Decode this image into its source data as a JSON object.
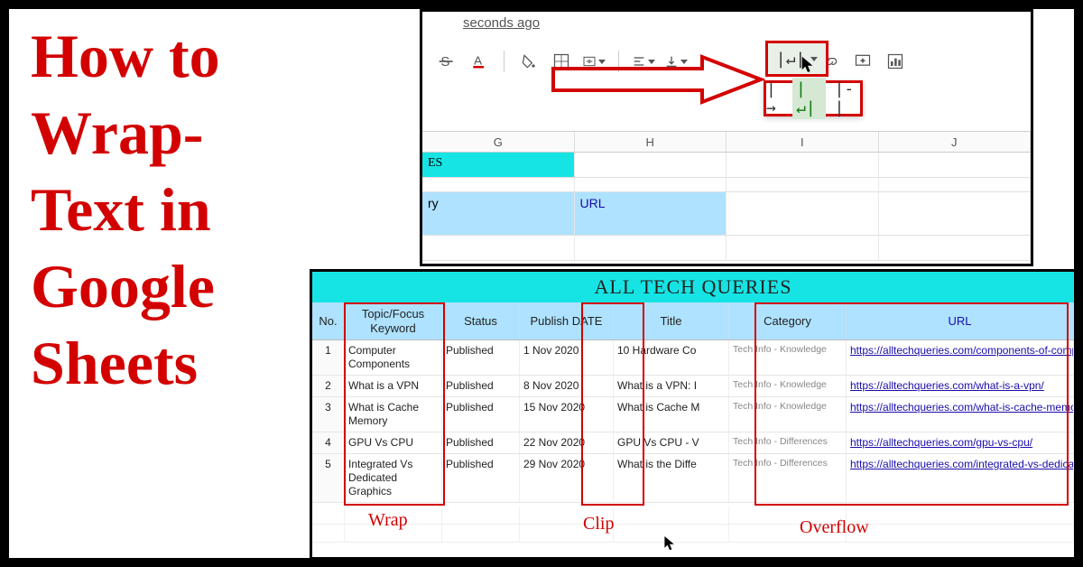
{
  "title_lines": "How to Wrap-Text in Google Sheets",
  "toolbar": {
    "status_text": "seconds ago",
    "col_headers": [
      "G",
      "H",
      "I",
      "J"
    ],
    "cell_es": "ES",
    "cell_ry": "ry",
    "cell_url": "URL"
  },
  "sheet": {
    "title": "ALL TECH QUERIES",
    "headers": {
      "no": "No.",
      "keyword": "Topic/Focus Keyword",
      "status": "Status",
      "date": "Publish DATE",
      "title": "Title",
      "category": "Category",
      "url": "URL"
    },
    "rows": [
      {
        "no": "1",
        "kw": "Computer Components",
        "st": "Published",
        "dt": "1 Nov 2020",
        "ti": "10 Hardware Co",
        "cat": "Tech Info - Knowledge",
        "url": "https://alltechqueries.com/components-of-computer/"
      },
      {
        "no": "2",
        "kw": "What is a VPN",
        "st": "Published",
        "dt": "8 Nov 2020",
        "ti": "What is a VPN: I",
        "cat": "Tech Info - Knowledge",
        "url": "https://alltechqueries.com/what-is-a-vpn/"
      },
      {
        "no": "3",
        "kw": "What is Cache Memory",
        "st": "Published",
        "dt": "15 Nov 2020",
        "ti": "What is Cache M",
        "cat": "Tech Info - Knowledge",
        "url": "https://alltechqueries.com/what-is-cache-memory/"
      },
      {
        "no": "4",
        "kw": "GPU Vs CPU",
        "st": "Published",
        "dt": "22 Nov 2020",
        "ti": "GPU Vs CPU - V",
        "cat": "Tech Info - Differences",
        "url": "https://alltechqueries.com/gpu-vs-cpu/"
      },
      {
        "no": "5",
        "kw": "Integrated Vs Dedicated Graphics",
        "st": "Published",
        "dt": "29 Nov 2020",
        "ti": "What is the Diffe",
        "cat": "Tech Info - Differences",
        "url": "https://alltechqueries.com/integrated-vs-dedicated-graphics/"
      }
    ],
    "labels": {
      "wrap": "Wrap",
      "clip": "Clip",
      "overflow": "Overflow"
    }
  }
}
